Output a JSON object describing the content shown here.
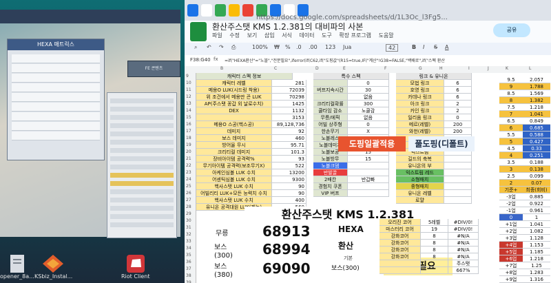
{
  "desktop": {
    "icons": [
      {
        "name": "file-icon",
        "label": "opener_8a..."
      },
      {
        "name": "installer-icon",
        "label": "KSbiz_Instal..."
      },
      {
        "name": "riot-client-icon",
        "label": "Riot Client"
      }
    ],
    "game": {
      "hexa_window_title": "HEXA 매트릭스",
      "mini_label": "FE 콘텐츠"
    }
  },
  "browser": {
    "url": "https://docs.google.com/spreadsheets/d/1L3Oc_l3Fg5...",
    "doc_title": "환산주스탯 KMS 1.2.381의 대비파의 사본",
    "menu": [
      "파일",
      "수정",
      "보기",
      "삽입",
      "서식",
      "데이터",
      "도구",
      "확장 프로그램",
      "도움말"
    ],
    "share_label": "공유",
    "toolbar": {
      "zoom": "100%",
      "currency": "₩",
      "percent": "%",
      "decimals": ".0",
      "decimals2": ".00",
      "num": "123",
      "font": "Jua",
      "font_size": "42"
    },
    "cell_ref": "F38:G40",
    "formula": "=if(\"HEXA환산\"=\"노블\",\"전분필요\",iferror(if(C62,if(\"도핑값\"(R15=true,IF(\"계산\"!G38=FALSE,\"백배로\",if(\"스펙 환산",
    "columns": [
      "A",
      "B",
      "C",
      "D",
      "E",
      "F",
      "G",
      "H",
      "I",
      "J",
      "K",
      "L"
    ],
    "rows": [
      "9",
      "10",
      "11",
      "12",
      "13",
      "14",
      "15",
      "16",
      "17",
      "18",
      "19",
      "20",
      "21",
      "22",
      "23",
      "24",
      "25",
      "26",
      "27",
      "28",
      "29",
      "30",
      "31",
      "32",
      "33",
      "34",
      "35",
      "36",
      "37",
      "38",
      "39",
      "40"
    ]
  },
  "sheet": {
    "header_left": "캐릭터 스펙 정보",
    "header_mid": "특수 스펙",
    "header_right": "링크 & 유니온",
    "left_rows": [
      {
        "label": "캐릭터 레벨",
        "value": "281"
      },
      {
        "label": "메용O LUK(시드링 착용)",
        "value": "72039"
      },
      {
        "label": "위 조건에서 메용만 끈 LUK",
        "value": "70298"
      },
      {
        "label": "AP(주스탯 꽁갑 외 날로수치)",
        "value": "1425"
      },
      {
        "label": "DEX",
        "value": "1132"
      },
      {
        "label": "",
        "value": "3153"
      },
      {
        "label": "메용O 스공(헥스공)",
        "value": "89,128,736"
      },
      {
        "label": "데미지",
        "value": "92"
      },
      {
        "label": "보스 데미지",
        "value": "460"
      },
      {
        "label": "방어율 무시",
        "value": "95.71"
      },
      {
        "label": "크리티컬 데미지",
        "value": "101.3"
      },
      {
        "label": "장비아이템 공격력%",
        "value": "93"
      },
      {
        "label": "무기아이템 공격력(보조무기X)",
        "value": "522"
      },
      {
        "label": "아케인심볼 LUK 수치",
        "value": "13200"
      },
      {
        "label": "어센틱심볼 LUK 수치",
        "value": "9300"
      },
      {
        "label": "헥사스탯 LUK 수치",
        "value": "90"
      },
      {
        "label": "어빌리티 LUK+모든 능력치 수치",
        "value": "90"
      },
      {
        "label": "헥사스탯 LUK 수치",
        "value": "400"
      },
      {
        "label": "유니온 공격대원 LUK(제논)",
        "value": "560"
      }
    ],
    "mid_rows": [
      {
        "label": "",
        "value": "0"
      },
      {
        "label": "버프지속시간",
        "value": "30"
      },
      {
        "label": "",
        "value": "없음"
      },
      {
        "label": "크리티컬확률",
        "value": "300"
      },
      {
        "label": "쿨타임 감소",
        "value": "노쿨감"
      },
      {
        "label": "무릉/에픽",
        "value": "없음"
      },
      {
        "label": "어빌 상주형",
        "value": "0"
      },
      {
        "label": "한손무기",
        "value": "X"
      },
      {
        "label": "노블레스",
        "value": "15"
      },
      {
        "label": "노블데미지",
        "value": "15"
      },
      {
        "label": "노블보공",
        "value": "15"
      },
      {
        "label": "노블방무",
        "value": "15"
      },
      {
        "label": "노블크뎀",
        "value": ""
      },
      {
        "label": "반발끌",
        "value": ""
      },
      {
        "label": "2배칸",
        "value": "반갑빠"
      },
      {
        "label": "경험치 쿠폰",
        "value": ""
      },
      {
        "label": "VIP 버프",
        "value": ""
      }
    ],
    "right_rows": [
      {
        "label": "모법 링크",
        "value": "6"
      },
      {
        "label": "호영 링크",
        "value": "6"
      },
      {
        "label": "카데나 링크",
        "value": "6"
      },
      {
        "label": "아크 링크",
        "value": "2"
      },
      {
        "label": "카인 링크",
        "value": "2"
      },
      {
        "label": "일리움 링크",
        "value": "0"
      },
      {
        "label": "메르(레벨)",
        "value": "200"
      },
      {
        "label": "와헌(레벨)",
        "value": "200"
      },
      {
        "label": "",
        "value": ""
      },
      {
        "label": "",
        "value": ""
      },
      {
        "label": "익스트림",
        "value": ""
      },
      {
        "label": "길드의 축복",
        "value": ""
      },
      {
        "label": "유니온의 부",
        "value": ""
      },
      {
        "label": "익스트림 레드",
        "value": ""
      },
      {
        "label": "소형패치",
        "value": ""
      },
      {
        "label": "중형패치",
        "value": ""
      },
      {
        "label": "유니온 레벨",
        "value": ""
      },
      {
        "label": "로얄",
        "value": ""
      }
    ],
    "side_table": [
      [
        "9.5",
        "2.057"
      ],
      [
        "9",
        "1.788"
      ],
      [
        "8.5",
        "1.569"
      ],
      [
        "8",
        "1.382"
      ],
      [
        "7.5",
        "1.218"
      ],
      [
        "7",
        "1.041"
      ],
      [
        "6.5",
        "0.849"
      ],
      [
        "6",
        "0.685"
      ],
      [
        "5.5",
        "0.588"
      ],
      [
        "5",
        "0.427"
      ],
      [
        "4.5",
        "0.33"
      ],
      [
        "4",
        "0.251"
      ],
      [
        "3.5",
        "0.188"
      ],
      [
        "3",
        "0.138"
      ],
      [
        "2.5",
        "0.099"
      ],
      [
        "2",
        "0.07"
      ]
    ],
    "side_header": [
      "기준+",
      "최종(회비)"
    ],
    "side_table2": [
      [
        "-3업",
        "0.885"
      ],
      [
        "-2업",
        "0.922"
      ],
      [
        "-1업",
        "0.961"
      ],
      [
        "0",
        "1"
      ],
      [
        "+1업",
        "1.041"
      ],
      [
        "+2업",
        "1.082"
      ],
      [
        "+3업",
        "1.128"
      ],
      [
        "+4업",
        "1.153"
      ],
      [
        "+5업",
        "1.185"
      ],
      [
        "+6업",
        "1.218"
      ],
      [
        "+7업",
        "1.25"
      ],
      [
        "+8업",
        "1.283"
      ],
      [
        "+9업",
        "1.316"
      ],
      [
        "+10업",
        "1.35"
      ]
    ],
    "banner_red": "도핑일괄적용",
    "banner_blue": "풀도핑(디폴트)",
    "big_title": "환산주스탯 KMS 1.2.381",
    "big_rows": [
      {
        "label": "무릉",
        "value": "68913"
      },
      {
        "label": "보스\n(300)",
        "value": "68994"
      },
      {
        "label": "보스\n(380)",
        "value": "69090"
      }
    ],
    "hexa_label": "HEXA",
    "hwan_label": "환산",
    "gibon_label": "기본",
    "boss300_label": "보스(300)",
    "jeonmun": "전분필요",
    "core_header": [
      "오리진 코어",
      "5레벨",
      "#DIV/0!"
    ],
    "core_rows": [
      [
        "마스터리 코어",
        "19",
        "#DIV/0!"
      ],
      [
        "강화코어",
        "8",
        "#N/A"
      ],
      [
        "강화코어",
        "8",
        "#N/A"
      ],
      [
        "강화코어",
        "8",
        "#N/A"
      ],
      [
        "강화코어",
        "8",
        "#N/A"
      ],
      [
        "",
        "",
        "주스탯"
      ],
      [
        "",
        "",
        "667%"
      ]
    ]
  }
}
